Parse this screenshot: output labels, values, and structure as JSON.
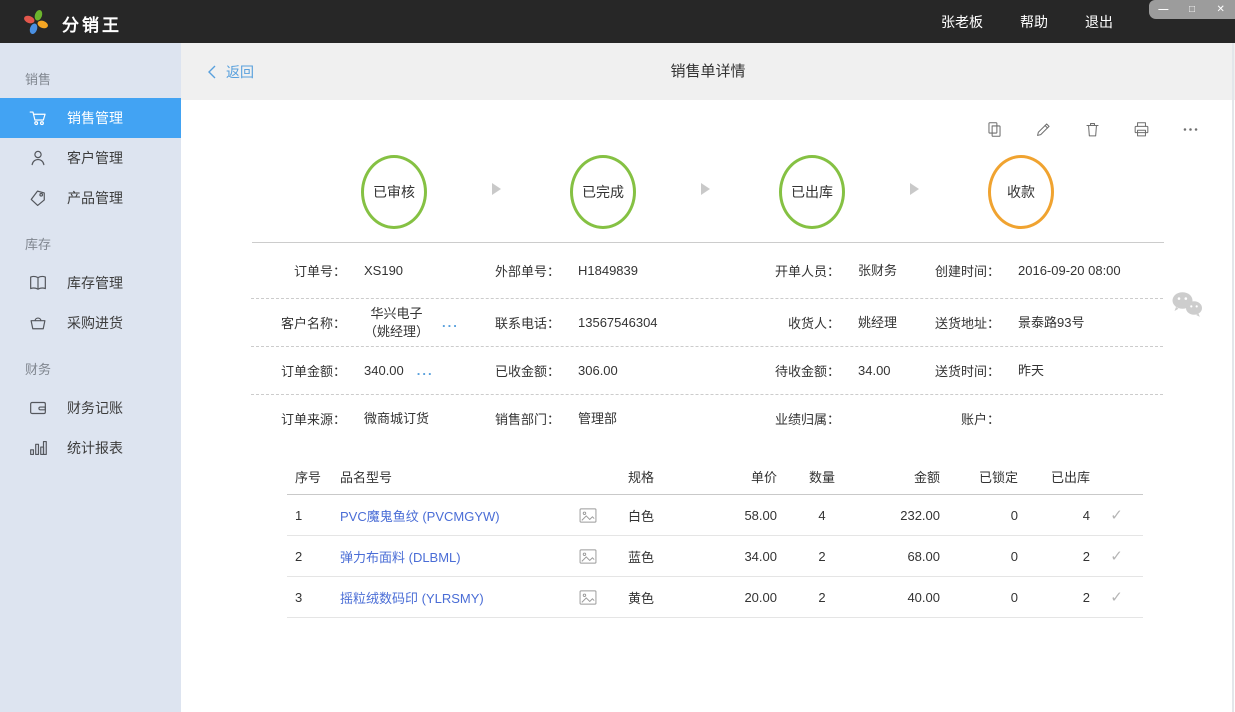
{
  "colors": {
    "topbar_bg": "#272727",
    "sidebar_bg": "#dde4f0",
    "active_item_blue": "#42a3f3",
    "link_blue": "#58a0dd",
    "product_link_blue": "#4a6dd6",
    "step_green": "#85c143",
    "step_orange": "#f0a330"
  },
  "titlebar": {
    "app_title": "分销王",
    "user": "张老板",
    "help": "帮助",
    "logout": "退出",
    "minimize_icon": "—",
    "maximize_icon": "□",
    "close_icon": "✕"
  },
  "sidebar": {
    "sections": [
      {
        "label": "销售",
        "items": [
          {
            "label": "销售管理",
            "icon": "cart-icon",
            "active": true
          },
          {
            "label": "客户管理",
            "icon": "person-icon",
            "active": false
          },
          {
            "label": "产品管理",
            "icon": "tag-icon",
            "active": false
          }
        ]
      },
      {
        "label": "库存",
        "items": [
          {
            "label": "库存管理",
            "icon": "book-icon",
            "active": false
          },
          {
            "label": "采购进货",
            "icon": "basket-icon",
            "active": false
          }
        ]
      },
      {
        "label": "财务",
        "items": [
          {
            "label": "财务记账",
            "icon": "wallet-icon",
            "active": false
          },
          {
            "label": "统计报表",
            "icon": "bar-chart-icon",
            "active": false
          }
        ]
      }
    ]
  },
  "header": {
    "back": "返回",
    "title": "销售单详情"
  },
  "toolbar": {
    "icons": [
      "copy-icon",
      "edit-icon",
      "delete-icon",
      "print-icon",
      "more-icon"
    ]
  },
  "status_flow": {
    "steps": [
      {
        "label": "已审核",
        "color": "#85c143"
      },
      {
        "label": "已完成",
        "color": "#85c143"
      },
      {
        "label": "已出库",
        "color": "#85c143"
      },
      {
        "label": "收款",
        "color": "#f0a330"
      }
    ]
  },
  "details": {
    "rows": [
      [
        {
          "label": "订单号：",
          "value": "XS190"
        },
        {
          "label": "外部单号：",
          "value": "H1849839"
        },
        {
          "label": "开单人员：",
          "value": "张财务"
        },
        {
          "label": "创建时间：",
          "value": "2016-09-20 08:00"
        }
      ],
      [
        {
          "label": "客户名称：",
          "value": "华兴电子\n（姚经理）",
          "more": "..."
        },
        {
          "label": "联系电话：",
          "value": "13567546304"
        },
        {
          "label": "收货人：",
          "value": "姚经理"
        },
        {
          "label": "送货地址：",
          "value": "景泰路93号"
        }
      ],
      [
        {
          "label": "订单金额：",
          "value": "340.00",
          "more": "..."
        },
        {
          "label": "已收金额：",
          "value": "306.00"
        },
        {
          "label": "待收金额：",
          "value": "34.00"
        },
        {
          "label": "送货时间：",
          "value": "昨天"
        }
      ],
      [
        {
          "label": "订单来源：",
          "value": "微商城订货"
        },
        {
          "label": "销售部门：",
          "value": "管理部"
        },
        {
          "label": "业绩归属：",
          "value": ""
        },
        {
          "label": "账户：",
          "value": ""
        }
      ]
    ]
  },
  "products": {
    "headers": {
      "seq": "序号",
      "name": "品名型号",
      "spec": "规格",
      "price": "单价",
      "qty": "数量",
      "amount": "金额",
      "locked": "已锁定",
      "out": "已出库"
    },
    "rows": [
      {
        "seq": "1",
        "name": "PVC魔鬼鱼纹 (PVCMGYW)",
        "spec": "白色",
        "price": "58.00",
        "qty": "4",
        "amount": "232.00",
        "locked": "0",
        "out": "4",
        "shipped_check": "✓"
      },
      {
        "seq": "2",
        "name": "弹力布面料 (DLBML)",
        "spec": "蓝色",
        "price": "34.00",
        "qty": "2",
        "amount": "68.00",
        "locked": "0",
        "out": "2",
        "shipped_check": "✓"
      },
      {
        "seq": "3",
        "name": "摇粒绒数码印 (YLRSMY)",
        "spec": "黄色",
        "price": "20.00",
        "qty": "2",
        "amount": "40.00",
        "locked": "0",
        "out": "2",
        "shipped_check": "✓"
      }
    ]
  }
}
